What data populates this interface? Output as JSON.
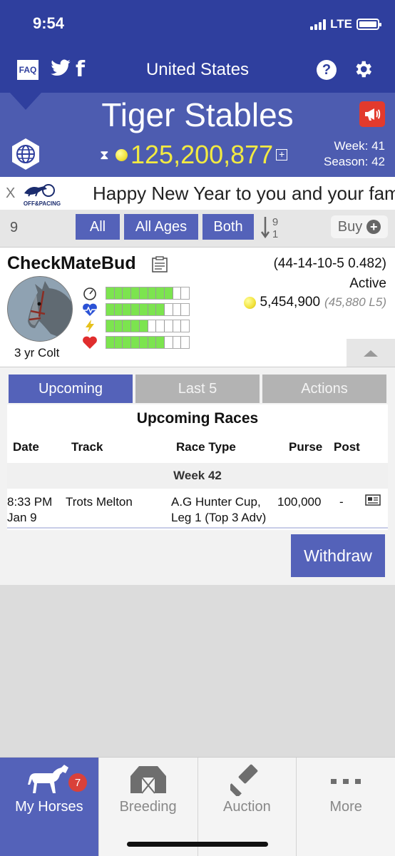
{
  "status_bar": {
    "time": "9:54",
    "network": "LTE"
  },
  "header": {
    "faq_label": "FAQ",
    "title": "United States",
    "help_label": "?"
  },
  "stable": {
    "name": "Tiger Stables",
    "balance": "125,200,877",
    "week_label": "Week: 41",
    "season_label": "Season: 42"
  },
  "ticker": {
    "close_label": "X",
    "logo_text": "OFF AND PACING",
    "message": "Happy New Year to you and your families!"
  },
  "filters": {
    "count": "9",
    "all": "All",
    "ages": "All Ages",
    "gender": "Both",
    "sort_top": "9",
    "sort_bottom": "1",
    "buy": "Buy"
  },
  "horse": {
    "name": "CheckMateBud",
    "record": "(44-14-10-5 0.482)",
    "status": "Active",
    "earnings": "5,454,900",
    "last5_earnings": "(45,880 L5)",
    "age": "3 yr Colt",
    "stats": [
      {
        "name": "speed",
        "level": 0.8
      },
      {
        "name": "health",
        "level": 0.7
      },
      {
        "name": "energy",
        "level": 0.5
      },
      {
        "name": "heart",
        "level": 0.7
      }
    ]
  },
  "races": {
    "tabs": [
      "Upcoming",
      "Last 5",
      "Actions"
    ],
    "title": "Upcoming Races",
    "columns": [
      "Date",
      "Track",
      "Race Type",
      "Purse",
      "Post"
    ],
    "week": "Week 42",
    "rows": [
      {
        "time": "8:33 PM",
        "date": "Jan 9",
        "track": "Trots Melton",
        "type_line1": "A.G Hunter Cup,",
        "type_line2": "Leg 1 (Top 3 Adv)",
        "purse": "100,000",
        "post": "-"
      }
    ],
    "withdraw": "Withdraw"
  },
  "tab_bar": {
    "items": [
      {
        "label": "My Horses",
        "badge": "7",
        "icon": "horse-icon"
      },
      {
        "label": "Breeding",
        "icon": "barn-icon"
      },
      {
        "label": "Auction",
        "icon": "gavel-icon"
      },
      {
        "label": "More",
        "icon": "more-icon"
      }
    ]
  },
  "colors": {
    "primary": "#2f3f9e",
    "accent": "#5462b9",
    "gold": "#f2ea42",
    "bar_fill": "#7ce44f",
    "badge": "#d9413a"
  }
}
